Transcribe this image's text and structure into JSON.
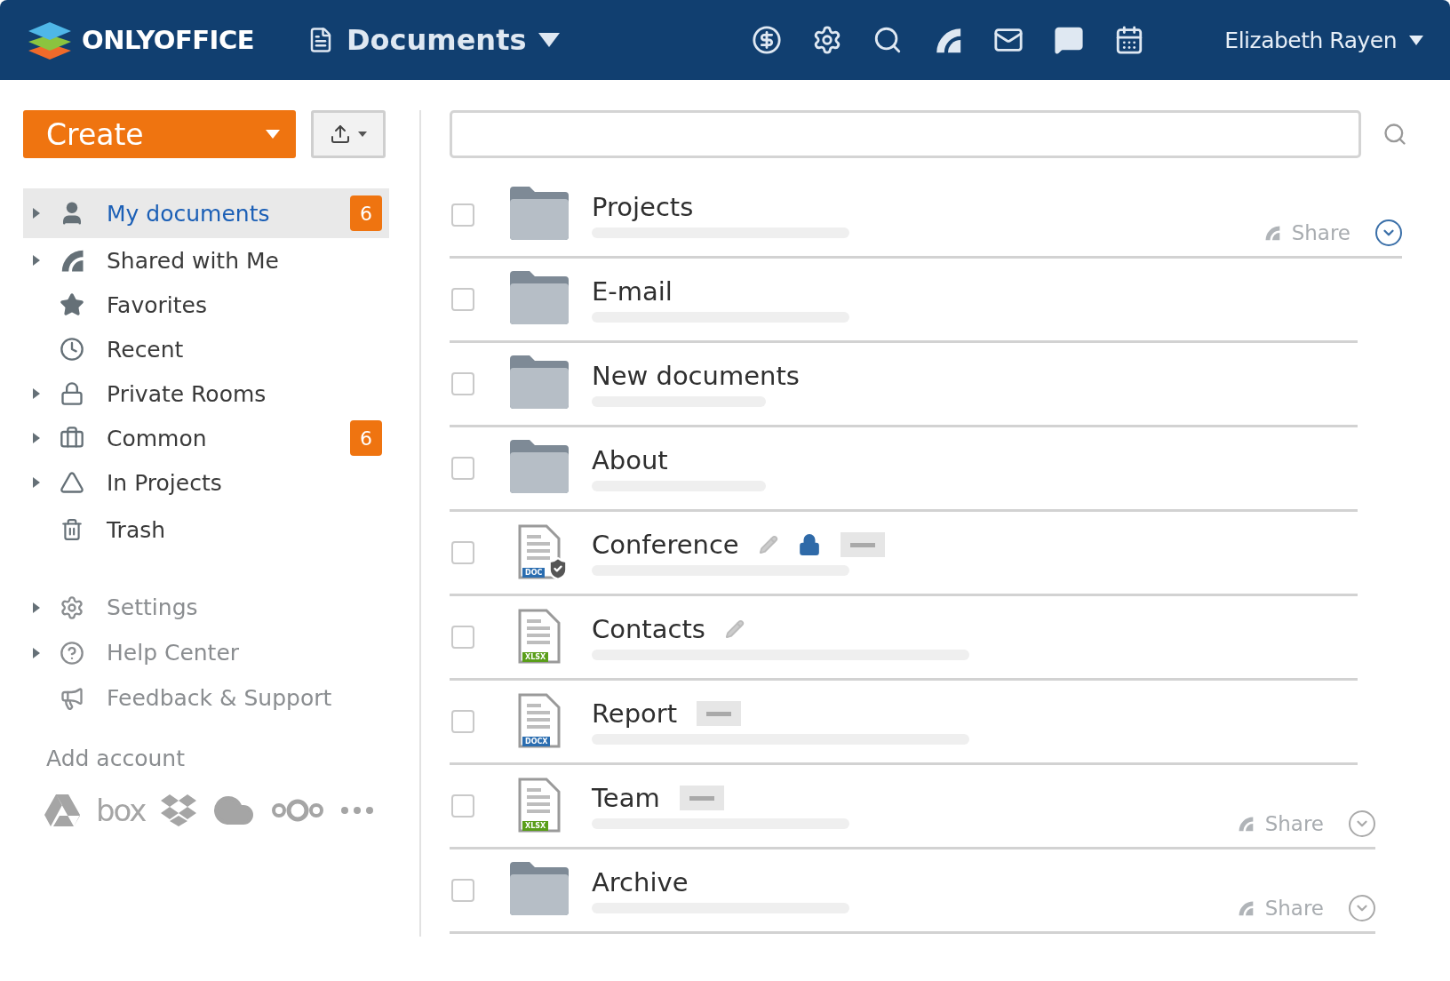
{
  "header": {
    "brand": "ONLYOFFICE",
    "module": "Documents",
    "user": "Elizabeth Rayen"
  },
  "sidebar": {
    "create_label": "Create",
    "items": [
      {
        "label": "My documents",
        "selected": true,
        "expandable": true,
        "badge": "6"
      },
      {
        "label": "Shared with Me",
        "selected": false,
        "expandable": true
      },
      {
        "label": "Favorites",
        "selected": false,
        "expandable": false
      },
      {
        "label": "Recent",
        "selected": false,
        "expandable": false
      },
      {
        "label": "Private Rooms",
        "selected": false,
        "expandable": true
      },
      {
        "label": "Common",
        "selected": false,
        "expandable": true,
        "badge": "6"
      },
      {
        "label": "In Projects",
        "selected": false,
        "expandable": true
      },
      {
        "label": "Trash",
        "selected": false,
        "expandable": false
      }
    ],
    "secondary": [
      {
        "label": "Settings",
        "expandable": true
      },
      {
        "label": "Help Center",
        "expandable": true
      },
      {
        "label": "Feedback & Support",
        "expandable": false
      }
    ],
    "add_account": {
      "title": "Add account",
      "box_logo": "box"
    }
  },
  "files": [
    {
      "kind": "folder",
      "name": "Projects",
      "checked": false,
      "share": "Share",
      "highlighted": true
    },
    {
      "kind": "folder",
      "name": "E-mail",
      "checked": false
    },
    {
      "kind": "folder",
      "name": "New documents",
      "checked": false
    },
    {
      "kind": "folder",
      "name": "About",
      "checked": false
    },
    {
      "kind": "docx",
      "name": "Conference",
      "format": "DOC",
      "checked": false,
      "protected": true,
      "edit_icon": true,
      "locked": true,
      "minus_tag": true
    },
    {
      "kind": "xlsx",
      "name": "Contacts",
      "format": "XLSX",
      "checked": false,
      "edit_icon": true
    },
    {
      "kind": "docx",
      "name": "Report",
      "format": "DOCX",
      "checked": false,
      "minus_tag": true
    },
    {
      "kind": "xlsx",
      "name": "Team",
      "format": "XLSX",
      "checked": false,
      "minus_tag": true,
      "share": "Share",
      "highlighted": false
    },
    {
      "kind": "folder",
      "name": "Archive",
      "checked": false,
      "share": "Share",
      "highlighted": false
    }
  ]
}
